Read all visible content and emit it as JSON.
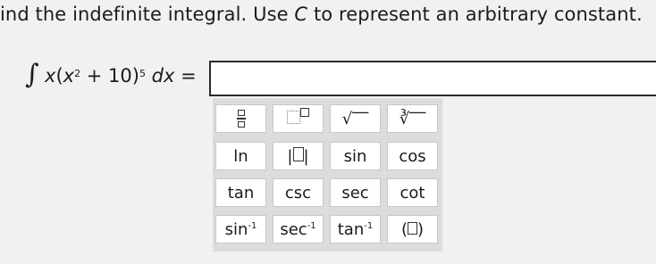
{
  "instruction": {
    "part1": "ind the indefinite integral. Use ",
    "var": "C",
    "part2": " to represent an arbitrary constant."
  },
  "equation": {
    "integral": "∫",
    "x1": "x",
    "open": "(",
    "x2": "x",
    "exp2": "2",
    "plus": " + 10)",
    "exp5": "5",
    "dx": " dx",
    "eq": " ="
  },
  "answer": {
    "value": ""
  },
  "keypad": {
    "keys": [
      {
        "label": "",
        "icon": "fraction-icon"
      },
      {
        "label": "",
        "icon": "exponent-icon"
      },
      {
        "label": "√‾‾",
        "icon": "square-root-icon"
      },
      {
        "label": "∛‾‾",
        "icon": "cube-root-icon"
      },
      {
        "label": "ln"
      },
      {
        "label": "",
        "icon": "absolute-value-icon"
      },
      {
        "label": "sin"
      },
      {
        "label": "cos"
      },
      {
        "label": "tan"
      },
      {
        "label": "csc"
      },
      {
        "label": "sec"
      },
      {
        "label": "cot"
      },
      {
        "label": "sin",
        "sup": "-1"
      },
      {
        "label": "sec",
        "sup": "-1"
      },
      {
        "label": "tan",
        "sup": "-1"
      },
      {
        "label": "",
        "icon": "parentheses-icon"
      }
    ]
  }
}
